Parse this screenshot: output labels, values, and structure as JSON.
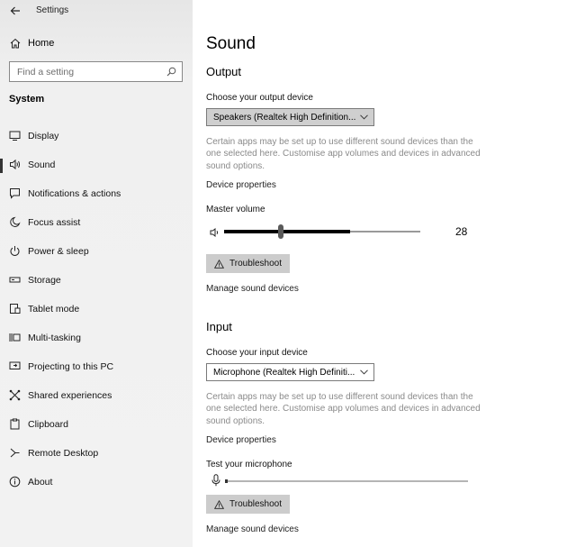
{
  "window": {
    "title": "Settings"
  },
  "sidebar": {
    "home_label": "Home",
    "search_placeholder": "Find a setting",
    "section_heading": "System",
    "items": [
      {
        "label": "Display",
        "icon": "monitor-icon"
      },
      {
        "label": "Sound",
        "icon": "speaker-icon",
        "active": true
      },
      {
        "label": "Notifications & actions",
        "icon": "notification-icon"
      },
      {
        "label": "Focus assist",
        "icon": "moon-icon"
      },
      {
        "label": "Power & sleep",
        "icon": "power-icon"
      },
      {
        "label": "Storage",
        "icon": "storage-icon"
      },
      {
        "label": "Tablet mode",
        "icon": "tablet-icon"
      },
      {
        "label": "Multi-tasking",
        "icon": "multitask-icon"
      },
      {
        "label": "Projecting to this PC",
        "icon": "projector-icon"
      },
      {
        "label": "Shared experiences",
        "icon": "shared-icon"
      },
      {
        "label": "Clipboard",
        "icon": "clipboard-icon"
      },
      {
        "label": "Remote Desktop",
        "icon": "remote-icon"
      },
      {
        "label": "About",
        "icon": "info-icon"
      }
    ]
  },
  "main": {
    "title": "Sound",
    "output": {
      "heading": "Output",
      "device_label": "Choose your output device",
      "device_value": "Speakers (Realtek High Definition...",
      "description": "Certain apps may be set up to use different sound devices than the one selected here. Customise app volumes and devices in advanced sound options.",
      "device_properties": "Device properties",
      "volume_label": "Master volume",
      "volume_value": "28",
      "volume_level": 0.64,
      "volume_thumb": 0.29,
      "troubleshoot": "Troubleshoot",
      "manage": "Manage sound devices"
    },
    "input": {
      "heading": "Input",
      "device_label": "Choose your input device",
      "device_value": "Microphone (Realtek High Definiti...",
      "description": "Certain apps may be set up to use different sound devices than the one selected here. Customise app volumes and devices in advanced sound options.",
      "device_properties": "Device properties",
      "test_label": "Test your microphone",
      "troubleshoot": "Troubleshoot",
      "manage": "Manage sound devices"
    }
  },
  "colors": {
    "sidebar_bg": "#f2f2f2",
    "button_bg": "#cccccc",
    "description_text": "#8a8a8a"
  }
}
